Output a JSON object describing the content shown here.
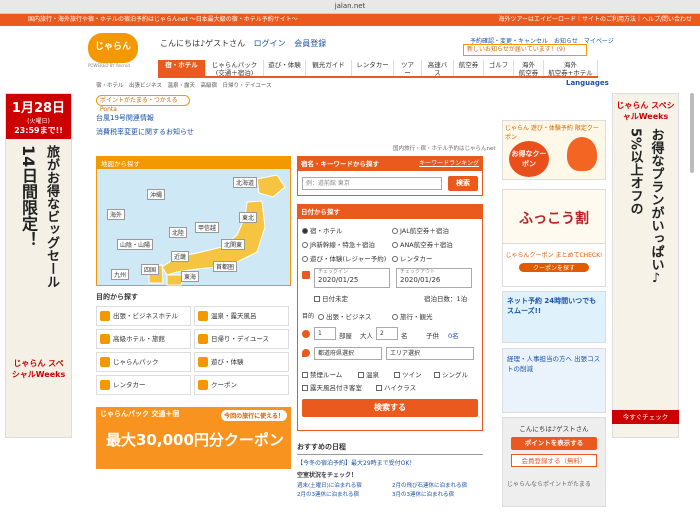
{
  "browser": {
    "url": "jalan.net"
  },
  "topbar": {
    "left_text": "国内旅行・海外旅行や宿・ホテルの宿泊予約はじゃらんnet 〜日本最大級の宿・ホテル予約サイト〜",
    "right_text": "海外ツアーはエイビーロード｜サイトのご利用方法｜ヘルプ/問い合わせ"
  },
  "header": {
    "logo": "じゃらん",
    "logo_sub": "POWERED BY Recruit",
    "greeting": "こんにちは♪ゲストさん",
    "login": "ログイン",
    "register": "会員登録",
    "toplinks": "予約確認・変更・キャンセル　お知らせ　マイページ",
    "notice": "新しいお知らせが届いています！(9)"
  },
  "nav": {
    "tabs": [
      "宿・ホテル",
      "じゃらんパック\n(交通＋宿泊)",
      "遊び・体験",
      "観光ガイド",
      "レンタカー",
      "ツアー",
      "高速バス",
      "航空券",
      "ゴルフ",
      "海外\n航空券",
      "海外\n航空券+ホテル"
    ],
    "subnav": "宿・ホテル　出張ビジネス　温泉・露天　高級宿　日帰り・デイユース",
    "languages": "Languages"
  },
  "left_ad": {
    "date": "1月28日",
    "weekday": "(火曜日)",
    "time": "23:59まで!!",
    "line1": "14日間限定！",
    "line2": "旅がお得なビッグセール",
    "brand": "じゃらん スペシャルWeeks"
  },
  "right_ad": {
    "line1": "5%以上オフの",
    "line2": "お得なプランがいっぱい♪",
    "brand": "じゃらん スペシャルWeeks",
    "check": "今すぐチェック"
  },
  "main": {
    "point_badge": "ポイントがたまる・つかえる Ponta",
    "links": [
      "台風19号関連情報",
      "消費税率変更に関するお知らせ"
    ],
    "tagline": "国内旅行・宿・ホテル予約はじゃらんnet"
  },
  "map": {
    "header": "地図から探す",
    "regions": [
      "北海道",
      "沖縄",
      "海外",
      "東北",
      "甲信越",
      "北陸",
      "北関東",
      "山陰・山陽",
      "近畿",
      "首都圏",
      "九州",
      "四国",
      "東海"
    ]
  },
  "categories": {
    "header": "目的から探す",
    "items": [
      "出張・ビジネスホテル",
      "温泉・露天風呂",
      "高級ホテル・旅館",
      "日帰り・デイユース",
      "じゃらんパック",
      "遊び・体験",
      "レンタカー",
      "クーポン"
    ]
  },
  "jpack": {
    "brand": "じゃらんパック 交通＋宿",
    "tag": "今回の旅行に使える！",
    "big": "最大30,000円分クーポン"
  },
  "search": {
    "header": "宿名・キーワードから探す",
    "ranking": "キーワードランキング",
    "placeholder": "例：道前館 東京",
    "button": "検索",
    "date_header": "日付から探す",
    "options": [
      "宿・ホテル",
      "JAL航空券＋宿泊",
      "JR新幹線・特急＋宿泊",
      "ANA航空券＋宿泊",
      "遊び・体験(レジャー予約)",
      "レンタカー"
    ],
    "checkin_label": "チェックイン",
    "checkin": "2020/01/25",
    "checkout_label": "チェックアウト",
    "checkout": "2020/01/26",
    "undecided": "日付未定",
    "nights": "宿泊日数：1泊",
    "purpose": "目的",
    "purpose_opts": [
      "出張・ビジネス",
      "旅行・観光"
    ],
    "rooms": "1",
    "rooms_label": "部屋",
    "adults_label": "大人",
    "adults": "2",
    "adults_unit": "名",
    "children": "子供",
    "children_val": "0名",
    "pref": "都道府県選択",
    "area": "エリア選択",
    "checks": [
      "禁煙ルーム",
      "温泉",
      "ツイン",
      "シングル",
      "露天風呂付き客室",
      "ハイクラス"
    ],
    "submit": "検索する"
  },
  "recommend": {
    "header": "おすすめの日程",
    "banner": "【今冬の宿泊予約】最大29時まで受付OK！",
    "sub": "空室状況をチェック！",
    "items": [
      "週末(土曜日)に泊まれる宿",
      "2月の飛び石連休に泊まれる宿",
      "2月の3連休に泊まれる宿",
      "3月の3連休に泊まれる宿"
    ]
  },
  "mini_ads": {
    "a1": "じゃらん 遊び・体験予約 限定クーポン",
    "a2": "お得なクーポン",
    "a3": "ふっこう割",
    "a4": "じゃらんクーポン まとめてCHECK!",
    "a4b": "クーポンを探す",
    "a5": "ネット予約 24時間いつでもスムーズ!!",
    "a6": "経理・人事担当の方へ 出張コストの削減"
  },
  "login_box": {
    "greet": "こんにちは♪ゲストさん",
    "points_btn": "ポイントを表示する",
    "register_btn": "会員登録する（無料）",
    "footer": "じゃらんならポイントがたまる"
  }
}
